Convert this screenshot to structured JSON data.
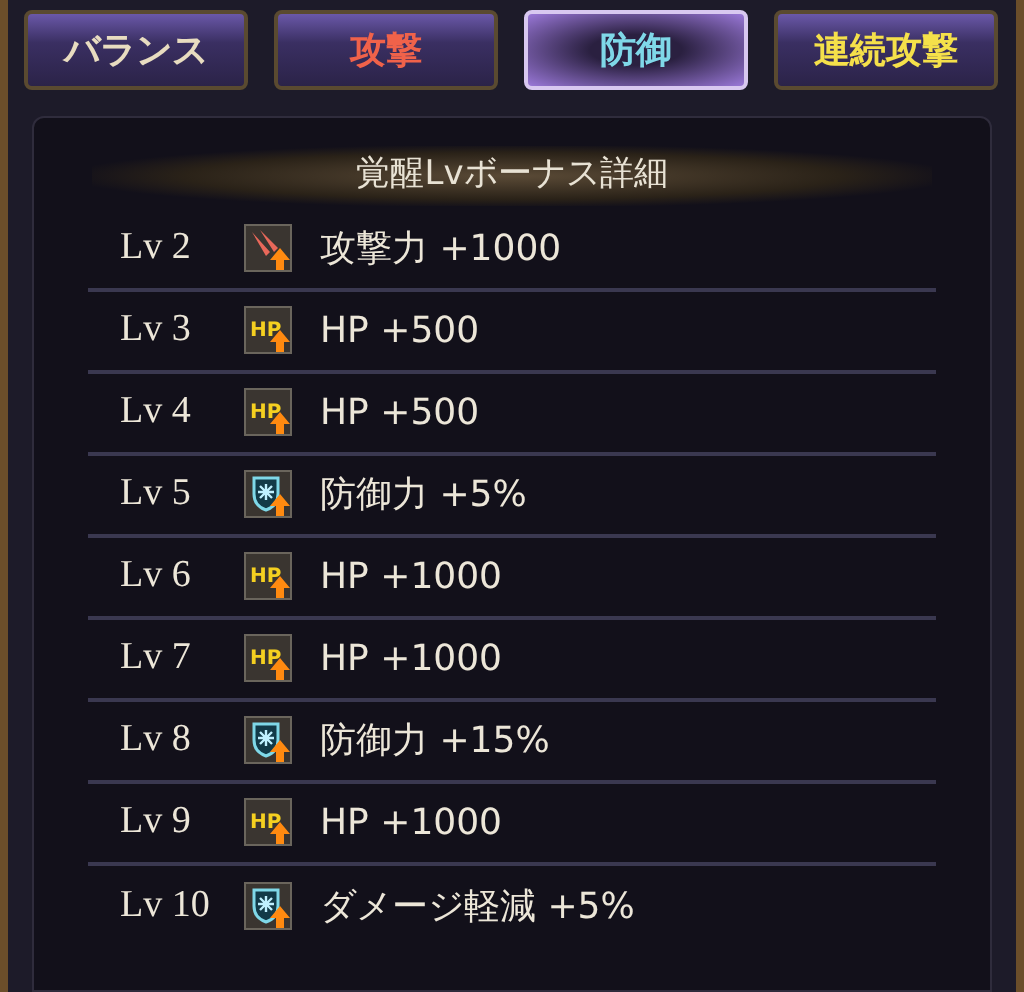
{
  "tabs": [
    {
      "label": "バランス",
      "selected": false,
      "kind": "balance"
    },
    {
      "label": "攻撃",
      "selected": false,
      "kind": "attack"
    },
    {
      "label": "防御",
      "selected": true,
      "kind": "defense"
    },
    {
      "label": "連続攻撃",
      "selected": false,
      "kind": "combo"
    }
  ],
  "panel": {
    "title": "覚醒Lvボーナス詳細",
    "rows": [
      {
        "level": "Lv 2",
        "kind": "attack",
        "bonus": "攻撃力 +1000"
      },
      {
        "level": "Lv 3",
        "kind": "hp",
        "icon_label": "HP",
        "bonus": "HP +500"
      },
      {
        "level": "Lv 4",
        "kind": "hp",
        "icon_label": "HP",
        "bonus": "HP +500"
      },
      {
        "level": "Lv 5",
        "kind": "defense",
        "bonus": "防御力 +5%"
      },
      {
        "level": "Lv 6",
        "kind": "hp",
        "icon_label": "HP",
        "bonus": "HP +1000"
      },
      {
        "level": "Lv 7",
        "kind": "hp",
        "icon_label": "HP",
        "bonus": "HP +1000"
      },
      {
        "level": "Lv 8",
        "kind": "defense",
        "bonus": "防御力 +15%"
      },
      {
        "level": "Lv 9",
        "kind": "hp",
        "icon_label": "HP",
        "bonus": "HP +1000"
      },
      {
        "level": "Lv 10",
        "kind": "defense",
        "bonus": "ダメージ軽減 +5%"
      }
    ]
  }
}
